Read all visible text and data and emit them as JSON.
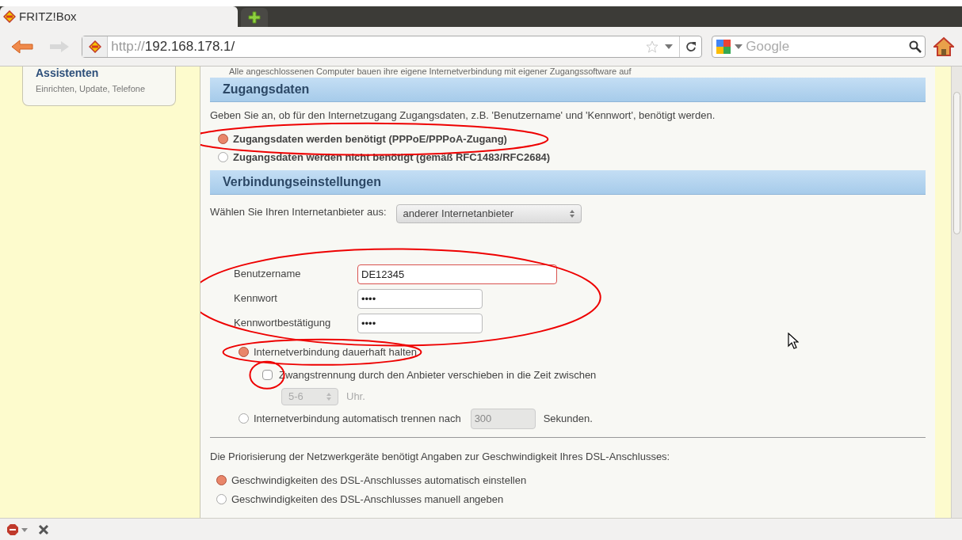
{
  "browser": {
    "tabs": [
      {
        "label": "FRITZ!Box",
        "selected": true
      }
    ],
    "url": {
      "scheme": "http://",
      "host": "192.168.178.1/"
    },
    "search": {
      "placeholder": "Google"
    }
  },
  "sidebar": {
    "title": "Assistenten",
    "subtitle": "Einrichten, Update, Telefone"
  },
  "page": {
    "intro": "Alle angeschlossenen Computer bauen ihre eigene Internetverbindung mit eigener Zugangssoftware auf",
    "access_section": {
      "title": "Zugangsdaten",
      "text": "Geben Sie an, ob für den Internetzugang Zugangsdaten, z.B. 'Benutzername' und 'Kennwort', benötigt werden.",
      "options": [
        {
          "label": "Zugangsdaten werden benötigt (PPPoE/PPPoA-Zugang)",
          "selected": true
        },
        {
          "label": "Zugangsdaten werden nicht benötigt (gemäß RFC1483/RFC2684)",
          "selected": false
        }
      ]
    },
    "connection_section": {
      "title": "Verbindungseinstellungen",
      "provider_label": "Wählen Sie Ihren Internetanbieter aus:",
      "provider_value": "anderer Internetanbieter",
      "fields": [
        {
          "label": "Benutzername",
          "value": "DE12345",
          "focused": true
        },
        {
          "label": "Kennwort",
          "value": "••••",
          "focused": false
        },
        {
          "label": "Kennwortbestätigung",
          "value": "••••",
          "focused": false
        }
      ],
      "keep_alive": {
        "label": "Internetverbindung dauerhaft halten",
        "selected": true
      },
      "forced_disconnect": {
        "label": "Zwangstrennung durch den Anbieter verschieben in die Zeit zwischen",
        "checked": false,
        "time_value": "5-6",
        "time_unit": "Uhr.",
        "disabled": true
      },
      "auto_disconnect": {
        "label": "Internetverbindung automatisch trennen nach",
        "selected": false,
        "value": "300",
        "unit": "Sekunden.",
        "disabled": true
      }
    },
    "speed": {
      "text": "Die Priorisierung der Netzwerkgeräte benötigt Angaben zur Geschwindigkeit Ihres DSL-Anschlusses:",
      "options": [
        {
          "label": "Geschwindigkeiten des DSL-Anschlusses automatisch einstellen",
          "selected": true
        },
        {
          "label": "Geschwindigkeiten des DSL-Anschlusses manuell angeben",
          "selected": false
        }
      ]
    }
  }
}
